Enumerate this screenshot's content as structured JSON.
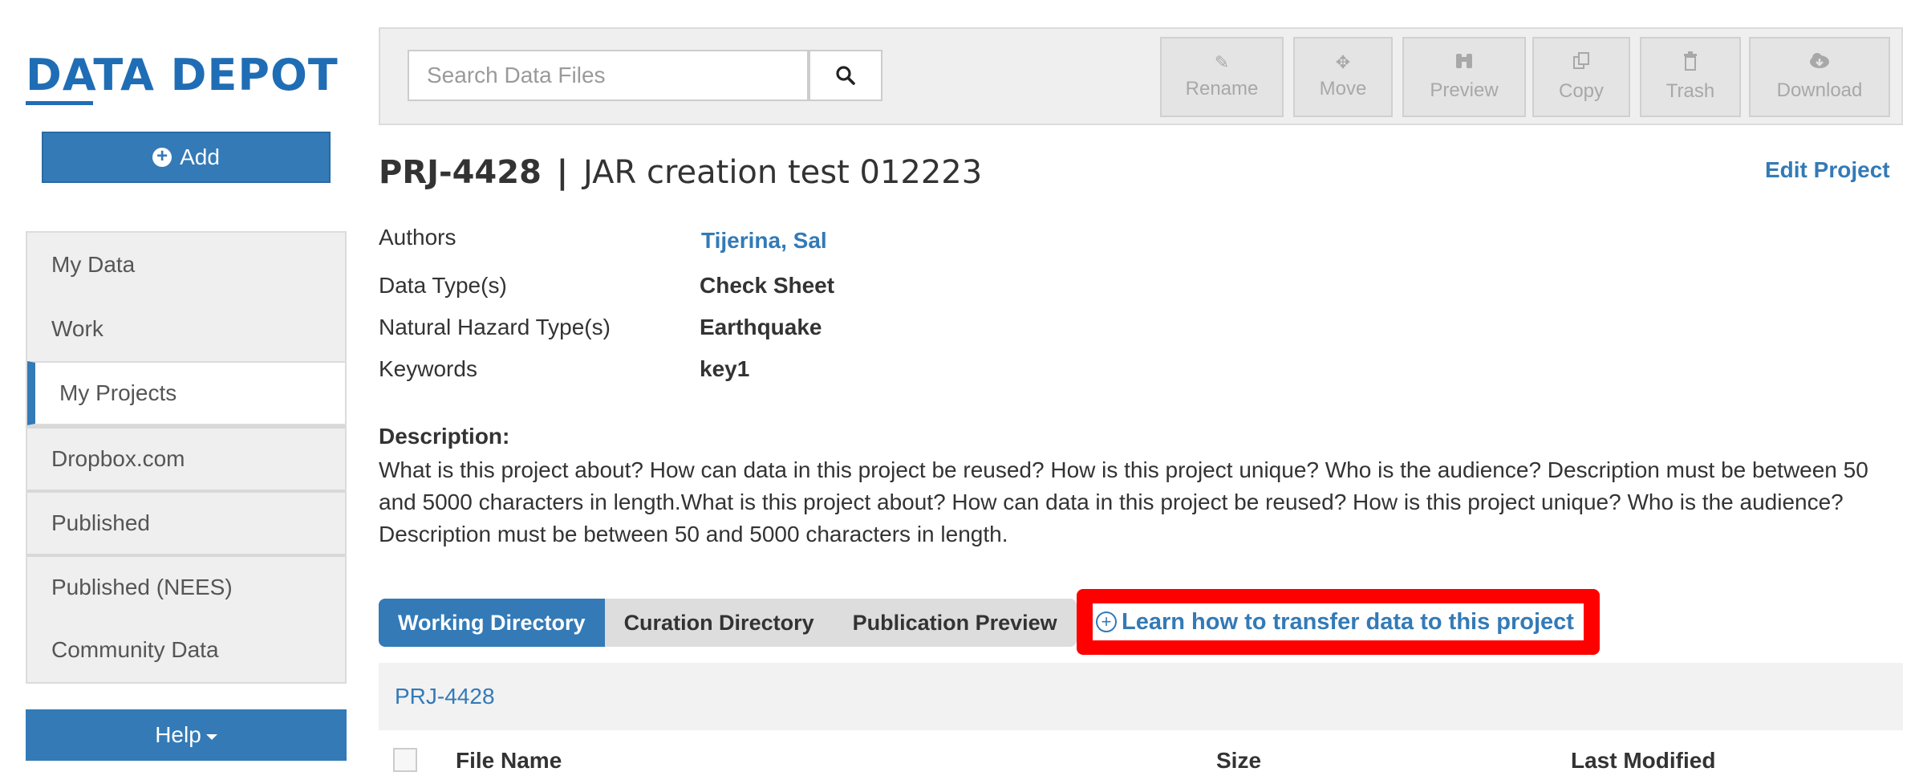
{
  "sidebar": {
    "logo": "DATA DEPOT",
    "add_label": "Add",
    "nav_items": [
      "My Data",
      "Work",
      "My Projects",
      "Dropbox.com",
      "Published",
      "Published (NEES)",
      "Community Data"
    ],
    "active_item": "My Projects",
    "help_label": "Help"
  },
  "toolbar": {
    "search_placeholder": "Search Data Files",
    "buttons": [
      {
        "label": "Rename",
        "icon": "pencil-icon"
      },
      {
        "label": "Move",
        "icon": "move-icon"
      },
      {
        "label": "Preview",
        "icon": "binoculars-icon"
      },
      {
        "label": "Copy",
        "icon": "copy-icon"
      },
      {
        "label": "Trash",
        "icon": "trash-icon"
      },
      {
        "label": "Download",
        "icon": "cloud-download-icon"
      }
    ]
  },
  "project": {
    "id": "PRJ-4428",
    "separator": "|",
    "title": "JAR creation test 012223",
    "edit_label": "Edit Project",
    "fields": [
      {
        "label": "Authors",
        "value": "Tijerina, Sal"
      },
      {
        "label": "Data Type(s)",
        "value": "Check Sheet"
      },
      {
        "label": "Natural Hazard Type(s)",
        "value": "Earthquake"
      },
      {
        "label": "Keywords",
        "value": "key1"
      }
    ],
    "description_label": "Description:",
    "description": "What is this project about? How can data in this project be reused? How is this project unique? Who is the audience? Description must be between 50 and 5000 characters in length.What is this project about? How can data in this project be reused? How is this project unique? Who is the audience? Description must be between 50 and 5000 characters in length."
  },
  "tabs": [
    "Working Directory",
    "Curation Directory",
    "Publication Preview"
  ],
  "active_tab": "Working Directory",
  "learn_link": "Learn how to transfer data to this project",
  "breadcrumb": "PRJ-4428",
  "table": {
    "columns": [
      "File Name",
      "Size",
      "Last Modified"
    ]
  },
  "colors": {
    "primary": "#337ab7",
    "logo": "#1f6db5",
    "highlight": "#ff0000"
  }
}
